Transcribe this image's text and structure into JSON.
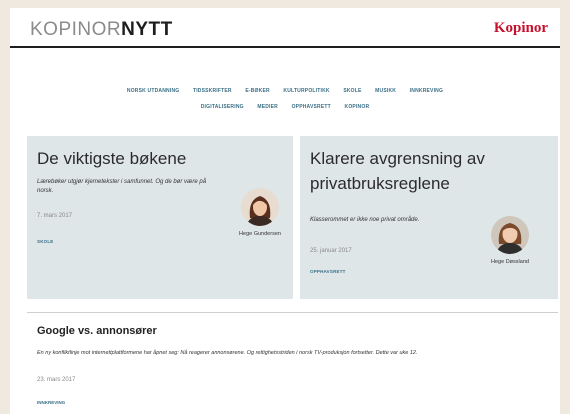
{
  "header": {
    "site_title_light": "KOPINOR",
    "site_title_bold": "NYTT",
    "brand": "Kopinor"
  },
  "nav": {
    "row1": [
      "Norsk utdanning",
      "Tidsskrifter",
      "E-bøker",
      "Kulturpolitikk",
      "Skole",
      "Musikk",
      "Innkreving"
    ],
    "row2": [
      "Digitalisering",
      "Medier",
      "Opphavsrett",
      "Kopinor"
    ]
  },
  "cards": [
    {
      "title": "De viktigste bøkene",
      "summary": "Lærebøker utgjør kjernetekster i samfunnet. Og de bør være på norsk.",
      "date": "7. mars 2017",
      "tag": "Skole",
      "author": "Hege Gundersen"
    },
    {
      "title": "Klarere avgrensning av privatbruksreglene",
      "summary": "Klasserommet er ikke noe privat område.",
      "date": "25. januar 2017",
      "tag": "Opphavsrett",
      "author": "Hege Døssland"
    }
  ],
  "article": {
    "title": "Google vs. annonsører",
    "summary": "En ny konfliktlinje mot internettplattformene har åpnet seg: Nå reagerer annonsørene. Og rettighetsstriden i norsk TV-produksjon fortsetter. Dette var uke 12.",
    "date": "23. mars 2017",
    "tag": "Innkreving"
  },
  "colors": {
    "accent": "#3a6f86",
    "brand": "#c8102e",
    "card_bg": "#dfe6e8",
    "outer_bg": "#efe9df"
  }
}
